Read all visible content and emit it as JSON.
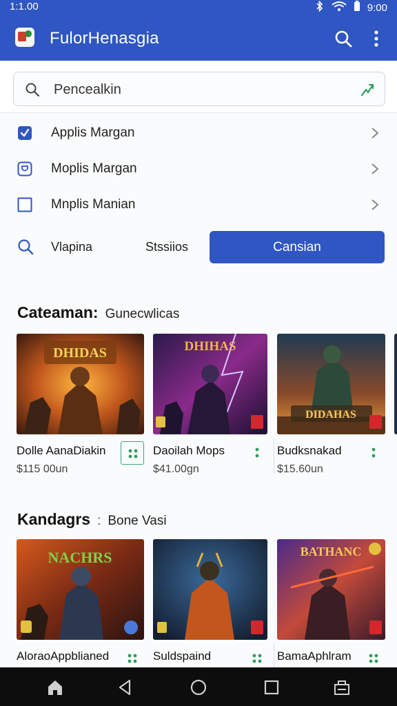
{
  "status": {
    "time_left": "1:1.00",
    "time_right": "9:00"
  },
  "app": {
    "title": "FulorHenasgia"
  },
  "search": {
    "placeholder": "Pencealkin"
  },
  "menu": {
    "items": [
      {
        "label": "Applis Margan"
      },
      {
        "label": "Moplis Margan"
      },
      {
        "label": "Mnplis Manian"
      }
    ]
  },
  "filter": {
    "label1": "Vlapina",
    "label2": "Stssiios",
    "button": "Cansian"
  },
  "sections": [
    {
      "title": "Cateaman:",
      "subtitle": "Gunecwlicas",
      "cards": [
        {
          "name": "Dolle AanaDiakin",
          "price": "$115 00un",
          "art_text": "DHIDAS"
        },
        {
          "name": "Daoilah Mops",
          "price": "$41.00gn",
          "art_text": "DHIHAS"
        },
        {
          "name": "Budksnakad",
          "price": "$15.60un",
          "art_text": "DIDAHAS"
        }
      ]
    },
    {
      "title": "Kandagrs",
      "subtitle": "Bone Vasi",
      "cards": [
        {
          "name": "AloraoAppblianed",
          "price": "",
          "art_text": "NACHRS"
        },
        {
          "name": "Suldspaind",
          "price": "",
          "art_text": ""
        },
        {
          "name": "BamaAphlram",
          "price": "",
          "art_text": "BATHANC"
        }
      ]
    }
  ],
  "colors": {
    "primary": "#2f56c2",
    "accent_green": "#2e9d5c",
    "nav": "#0d0d0d"
  }
}
